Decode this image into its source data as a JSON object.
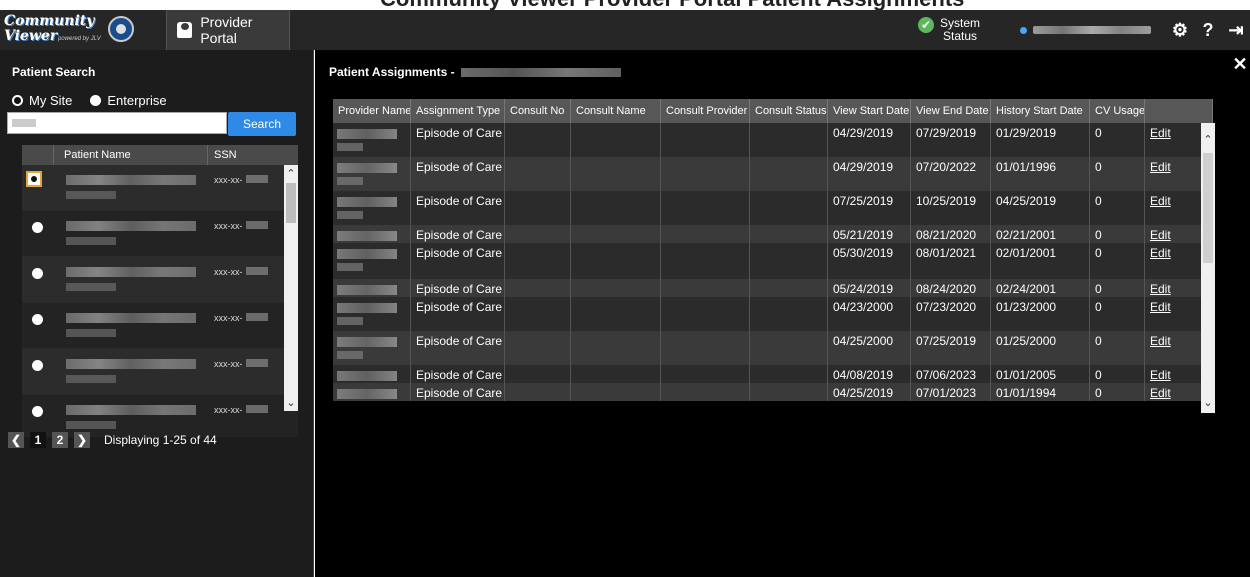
{
  "banner": {
    "text": "Community Viewer Provider Portal Patient Assignments"
  },
  "header": {
    "logo_line1": "Community",
    "logo_line2": "Viewer",
    "logo_powered": "powered by JLV",
    "portal_label": "Provider Portal",
    "status_line1": "System",
    "status_line2": "Status",
    "icons": [
      "gear-icon",
      "help-icon",
      "logout-icon"
    ]
  },
  "patient_search": {
    "title": "Patient Search",
    "radio_my_site": "My Site",
    "radio_enterprise": "Enterprise",
    "search_button": "Search",
    "columns": [
      "",
      "Patient Name",
      "SSN"
    ],
    "ssn_prefix": "xxx-xx-",
    "rows": [
      {
        "selected": true
      },
      {
        "selected": false
      },
      {
        "selected": false
      },
      {
        "selected": false
      },
      {
        "selected": false
      },
      {
        "selected": false
      }
    ],
    "pager": {
      "pages": [
        "1",
        "2"
      ],
      "current": "1",
      "info": "Displaying 1-25 of 44"
    }
  },
  "assignments": {
    "title": "Patient Assignments -",
    "columns": [
      "Provider Name",
      "Assignment Type",
      "Consult No",
      "Consult Name",
      "Consult Provider",
      "Consult Status",
      "View Start Date",
      "View End Date",
      "History Start Date",
      "CV Usage",
      ""
    ],
    "edit_label": "Edit",
    "rows": [
      {
        "type": "Episode of Care",
        "view_start": "04/29/2019",
        "view_end": "07/29/2019",
        "history_start": "01/29/2019",
        "cv_usage": "0",
        "h": 34
      },
      {
        "type": "Episode of Care",
        "view_start": "04/29/2019",
        "view_end": "07/20/2022",
        "history_start": "01/01/1996",
        "cv_usage": "0",
        "h": 34
      },
      {
        "type": "Episode of Care",
        "view_start": "07/25/2019",
        "view_end": "10/25/2019",
        "history_start": "04/25/2019",
        "cv_usage": "0",
        "h": 34
      },
      {
        "type": "Episode of Care",
        "view_start": "05/21/2019",
        "view_end": "08/21/2020",
        "history_start": "02/21/2001",
        "cv_usage": "0",
        "h": 18
      },
      {
        "type": "Episode of Care",
        "view_start": "05/30/2019",
        "view_end": "08/01/2021",
        "history_start": "02/01/2001",
        "cv_usage": "0",
        "h": 36
      },
      {
        "type": "Episode of Care",
        "view_start": "05/24/2019",
        "view_end": "08/24/2020",
        "history_start": "02/24/2001",
        "cv_usage": "0",
        "h": 18
      },
      {
        "type": "Episode of Care",
        "view_start": "04/23/2000",
        "view_end": "07/23/2020",
        "history_start": "01/23/2000",
        "cv_usage": "0",
        "h": 34
      },
      {
        "type": "Episode of Care",
        "view_start": "04/25/2000",
        "view_end": "07/25/2019",
        "history_start": "01/25/2000",
        "cv_usage": "0",
        "h": 34
      },
      {
        "type": "Episode of Care",
        "view_start": "04/08/2019",
        "view_end": "07/06/2023",
        "history_start": "01/01/2005",
        "cv_usage": "0",
        "h": 18
      },
      {
        "type": "Episode of Care",
        "view_start": "04/25/2019",
        "view_end": "07/01/2023",
        "history_start": "01/01/1994",
        "cv_usage": "0",
        "h": 18
      }
    ]
  }
}
